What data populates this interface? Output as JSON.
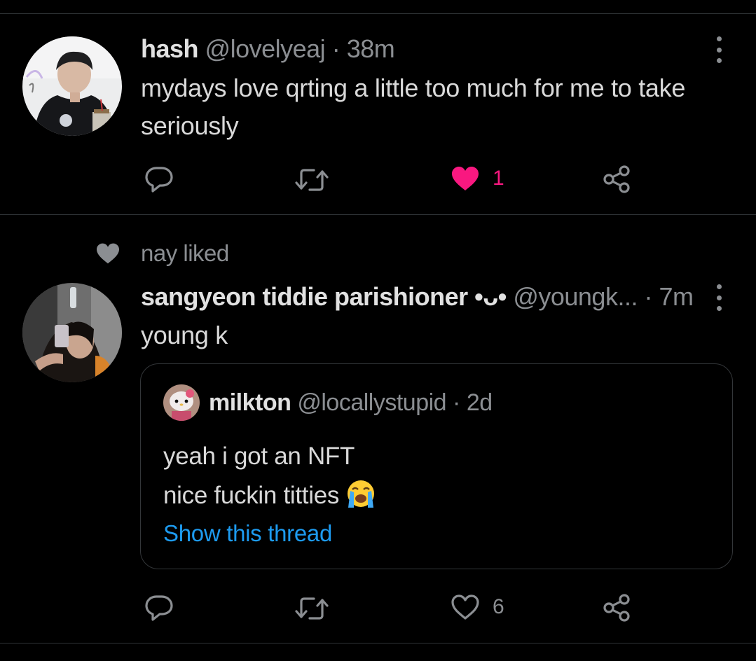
{
  "colors": {
    "background": "#000000",
    "text": "#d9d9d9",
    "muted": "#8b8e92",
    "like": "#f91880",
    "link": "#1d9bf0",
    "divider": "#2f3336"
  },
  "tweets": [
    {
      "display_name": "hash",
      "handle": "@lovelyeaj",
      "separator": "·",
      "time": "38m",
      "text_lines": [
        "mydays love qrting a little too much for me to take",
        "seriously"
      ],
      "actions": {
        "reply_icon": "reply-icon",
        "retweet_icon": "retweet-icon",
        "like_icon": "heart-filled-icon",
        "like_count": "1",
        "liked": true,
        "share_icon": "share-icon"
      }
    },
    {
      "social_context": "nay liked",
      "display_name": "sangyeon tiddie parishioner •ᴗ•",
      "handle": "@youngk...",
      "separator": "·",
      "time": "7m",
      "text_lines": [
        "young k"
      ],
      "quoted": {
        "display_name": "milkton",
        "handle": "@locallystupid",
        "separator": "·",
        "time": "2d",
        "text_lines": [
          "yeah i got an NFT",
          "nice fuckin titties"
        ],
        "emoji": "loudly-crying-face",
        "show_thread": "Show this thread"
      },
      "actions": {
        "reply_icon": "reply-icon",
        "retweet_icon": "retweet-icon",
        "like_icon": "heart-outline-icon",
        "like_count": "6",
        "liked": false,
        "share_icon": "share-icon"
      }
    }
  ]
}
